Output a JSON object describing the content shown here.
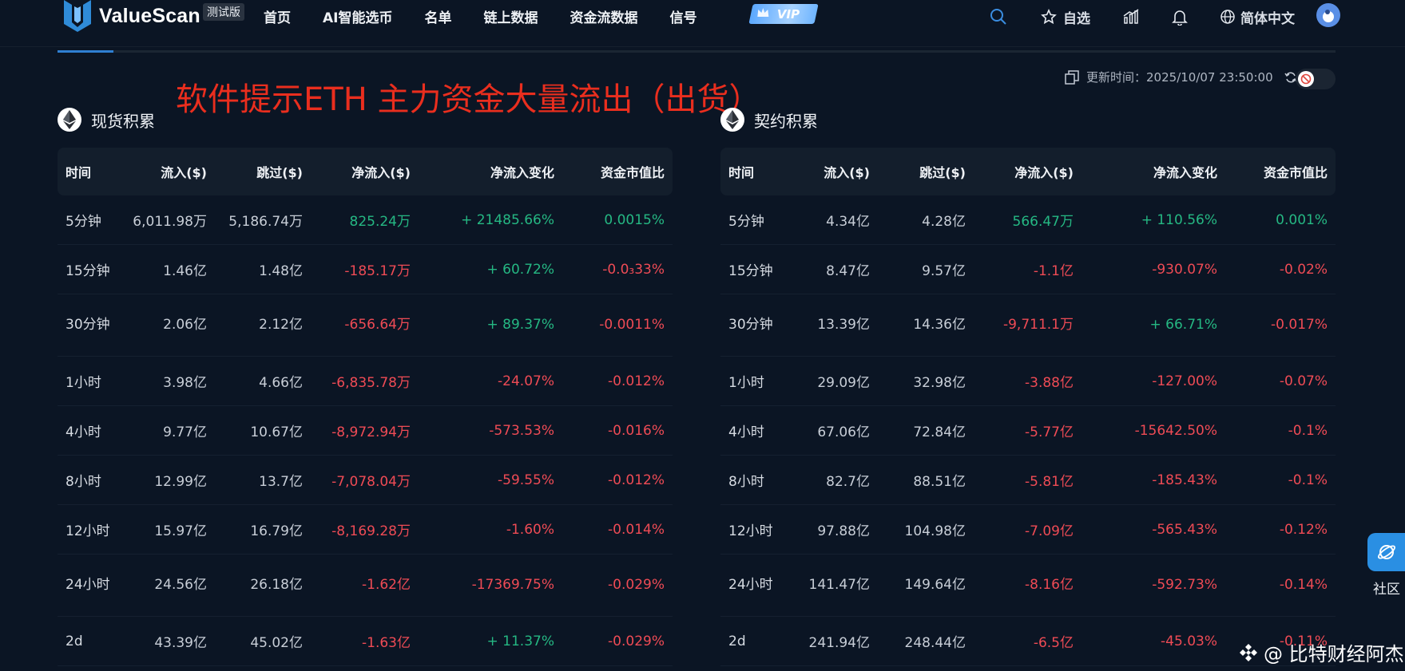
{
  "app": {
    "brand": "ValueScan",
    "beta": "测试版"
  },
  "nav": [
    "首页",
    "AI智能选币",
    "名单",
    "链上数据",
    "资金流数据",
    "信号"
  ],
  "vip": "VIP",
  "header_right": {
    "watchlist": "自选",
    "language": "简体中文"
  },
  "annotation": "软件提示ETH 主力资金大量流出（出货）",
  "update": {
    "label": "更新时间：",
    "time": "2025/10/07 23:50:00"
  },
  "colors": {
    "positive": "#25b883",
    "negative": "#ef4b55",
    "accent": "#2f7fd2",
    "annotation": "#ea2e1e"
  },
  "columns": [
    "时间",
    "流入($)",
    "跳过($)",
    "净流入($)",
    "净流入变化",
    "资金市值比"
  ],
  "spot": {
    "title": "现货积累",
    "rows": [
      {
        "time": "5分钟",
        "inflow": "6,011.98万",
        "skip": "5,186.74万",
        "net": "825.24万",
        "change": "+ 21485.66%",
        "ratio": "0.0015%",
        "net_sign": "pos",
        "change_sign": "pos",
        "ratio_sign": "pos"
      },
      {
        "time": "15分钟",
        "inflow": "1.46亿",
        "skip": "1.48亿",
        "net": "-185.17万",
        "change": "+ 60.72%",
        "ratio": "-0.0₃33%",
        "net_sign": "neg",
        "change_sign": "pos",
        "ratio_sign": "neg"
      },
      {
        "time": "30分钟",
        "inflow": "2.06亿",
        "skip": "2.12亿",
        "net": "-656.64万",
        "change": "+ 89.37%",
        "ratio": "-0.0011%",
        "net_sign": "neg",
        "change_sign": "pos",
        "ratio_sign": "neg"
      },
      {
        "time": "1小时",
        "inflow": "3.98亿",
        "skip": "4.66亿",
        "net": "-6,835.78万",
        "change": "-24.07%",
        "ratio": "-0.012%",
        "net_sign": "neg",
        "change_sign": "neg",
        "ratio_sign": "neg"
      },
      {
        "time": "4小时",
        "inflow": "9.77亿",
        "skip": "10.67亿",
        "net": "-8,972.94万",
        "change": "-573.53%",
        "ratio": "-0.016%",
        "net_sign": "neg",
        "change_sign": "neg",
        "ratio_sign": "neg"
      },
      {
        "time": "8小时",
        "inflow": "12.99亿",
        "skip": "13.7亿",
        "net": "-7,078.04万",
        "change": "-59.55%",
        "ratio": "-0.012%",
        "net_sign": "neg",
        "change_sign": "neg",
        "ratio_sign": "neg"
      },
      {
        "time": "12小时",
        "inflow": "15.97亿",
        "skip": "16.79亿",
        "net": "-8,169.28万",
        "change": "-1.60%",
        "ratio": "-0.014%",
        "net_sign": "neg",
        "change_sign": "neg",
        "ratio_sign": "neg"
      },
      {
        "time": "24小时",
        "inflow": "24.56亿",
        "skip": "26.18亿",
        "net": "-1.62亿",
        "change": "-17369.75%",
        "ratio": "-0.029%",
        "net_sign": "neg",
        "change_sign": "neg",
        "ratio_sign": "neg"
      },
      {
        "time": "2d",
        "inflow": "43.39亿",
        "skip": "45.02亿",
        "net": "-1.63亿",
        "change": "+ 11.37%",
        "ratio": "-0.029%",
        "net_sign": "neg",
        "change_sign": "pos",
        "ratio_sign": "neg"
      }
    ]
  },
  "futures": {
    "title": "契约积累",
    "rows": [
      {
        "time": "5分钟",
        "inflow": "4.34亿",
        "skip": "4.28亿",
        "net": "566.47万",
        "change": "+ 110.56%",
        "ratio": "0.001%",
        "net_sign": "pos",
        "change_sign": "pos",
        "ratio_sign": "pos"
      },
      {
        "time": "15分钟",
        "inflow": "8.47亿",
        "skip": "9.57亿",
        "net": "-1.1亿",
        "change": "-930.07%",
        "ratio": "-0.02%",
        "net_sign": "neg",
        "change_sign": "neg",
        "ratio_sign": "neg"
      },
      {
        "time": "30分钟",
        "inflow": "13.39亿",
        "skip": "14.36亿",
        "net": "-9,711.1万",
        "change": "+ 66.71%",
        "ratio": "-0.017%",
        "net_sign": "neg",
        "change_sign": "pos",
        "ratio_sign": "neg"
      },
      {
        "time": "1小时",
        "inflow": "29.09亿",
        "skip": "32.98亿",
        "net": "-3.88亿",
        "change": "-127.00%",
        "ratio": "-0.07%",
        "net_sign": "neg",
        "change_sign": "neg",
        "ratio_sign": "neg"
      },
      {
        "time": "4小时",
        "inflow": "67.06亿",
        "skip": "72.84亿",
        "net": "-5.77亿",
        "change": "-15642.50%",
        "ratio": "-0.1%",
        "net_sign": "neg",
        "change_sign": "neg",
        "ratio_sign": "neg"
      },
      {
        "time": "8小时",
        "inflow": "82.7亿",
        "skip": "88.51亿",
        "net": "-5.81亿",
        "change": "-185.43%",
        "ratio": "-0.1%",
        "net_sign": "neg",
        "change_sign": "neg",
        "ratio_sign": "neg"
      },
      {
        "time": "12小时",
        "inflow": "97.88亿",
        "skip": "104.98亿",
        "net": "-7.09亿",
        "change": "-565.43%",
        "ratio": "-0.12%",
        "net_sign": "neg",
        "change_sign": "neg",
        "ratio_sign": "neg"
      },
      {
        "time": "24小时",
        "inflow": "141.47亿",
        "skip": "149.64亿",
        "net": "-8.16亿",
        "change": "-592.73%",
        "ratio": "-0.14%",
        "net_sign": "neg",
        "change_sign": "neg",
        "ratio_sign": "neg"
      },
      {
        "time": "2d",
        "inflow": "241.94亿",
        "skip": "248.44亿",
        "net": "-6.5亿",
        "change": "-45.03%",
        "ratio": "-0.11%",
        "net_sign": "neg",
        "change_sign": "neg",
        "ratio_sign": "neg"
      }
    ]
  },
  "community": {
    "label": "社区"
  },
  "watermark": "@ 比特财经阿杰"
}
